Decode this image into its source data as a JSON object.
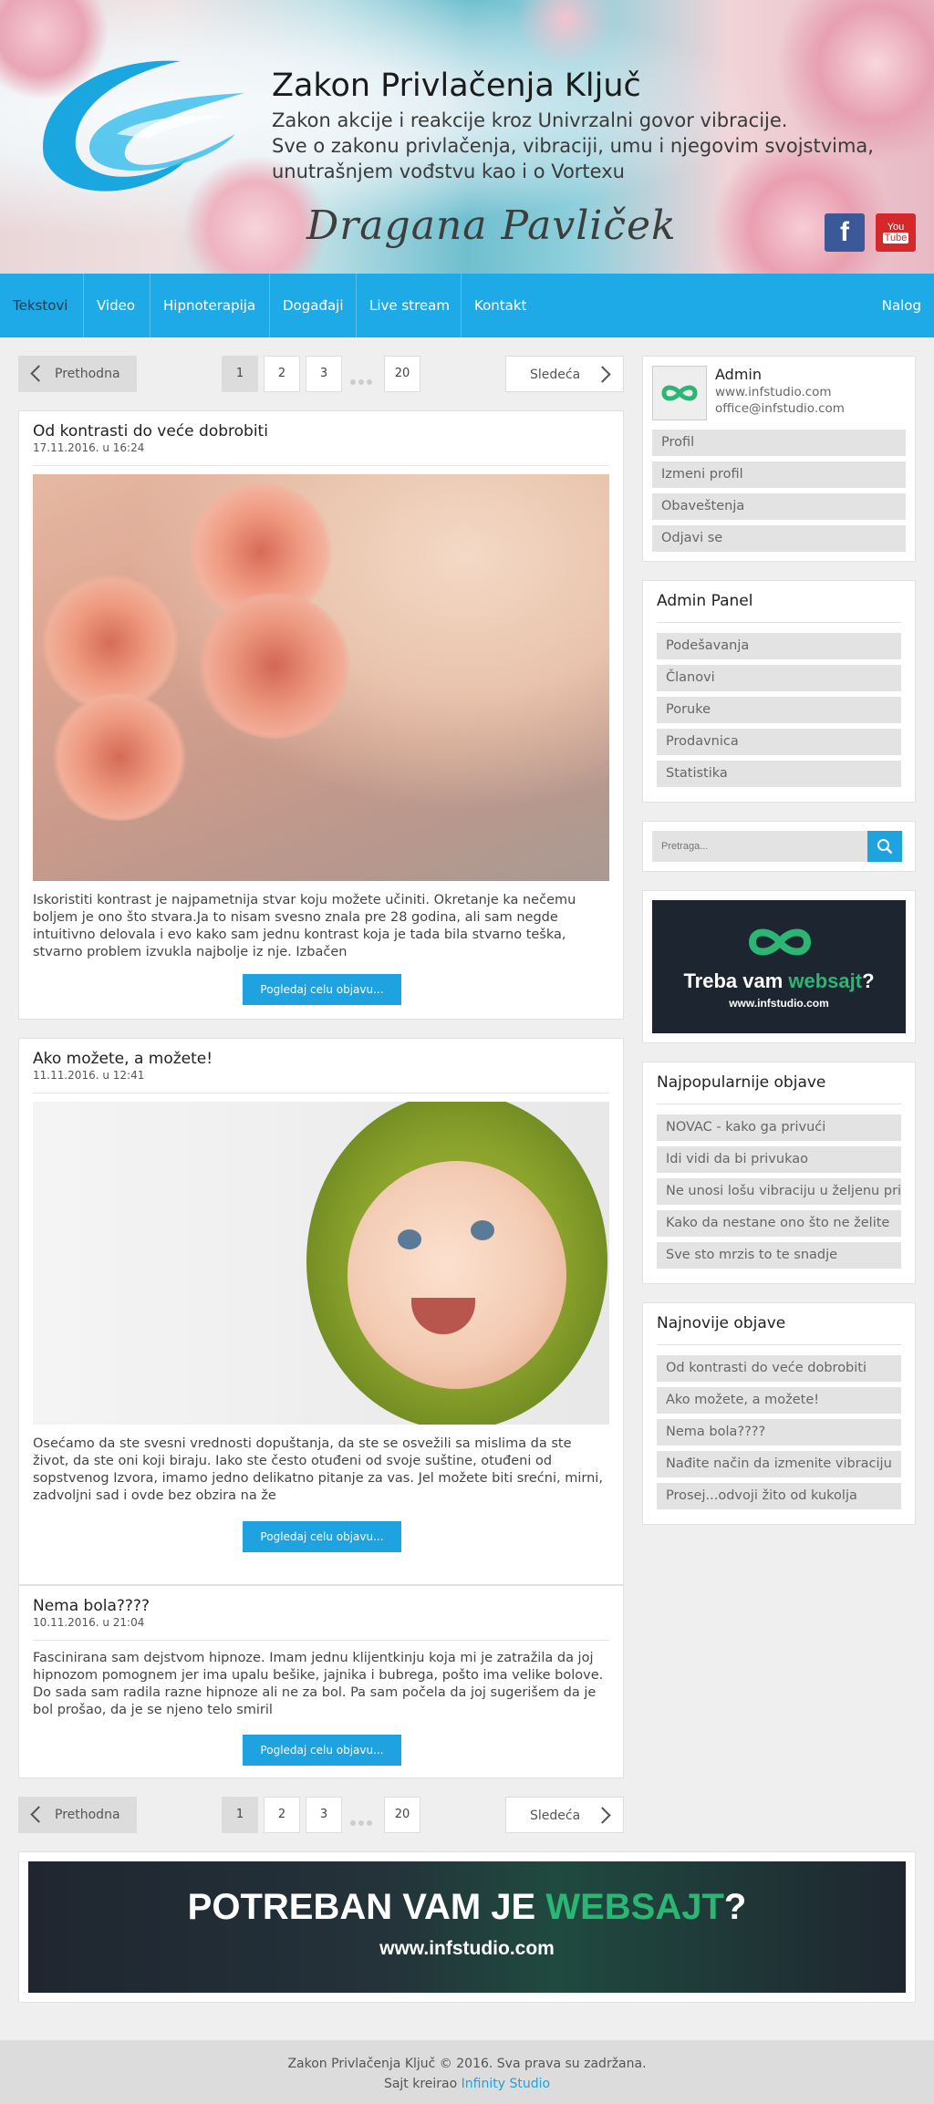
{
  "header": {
    "title": "Zakon Privlačenja Ključ",
    "tagline_lines": [
      "Zakon akcije i reakcije kroz Univrzalni govor vibracije.",
      "Sve o zakonu privlačenja, vibraciji, umu i njegovim svojstvima,",
      "unutrašnjem vođstvu kao i o Vortexu"
    ],
    "signature": "Dragana Pavliček",
    "social": {
      "facebook_glyph": "f",
      "youtube_line1": "You",
      "youtube_line2": "Tube"
    }
  },
  "nav": {
    "items": [
      "Tekstovi",
      "Video",
      "Hipnoterapija",
      "Događaji",
      "Live stream",
      "Kontakt"
    ],
    "account": "Nalog",
    "color": "#1eaae7"
  },
  "pager": {
    "prev": "Prethodna",
    "next": "Sledeća",
    "pages": [
      "1",
      "2",
      "3",
      "20"
    ],
    "current": "1"
  },
  "posts": [
    {
      "title": "Od kontrasti do veće dobrobiti",
      "date": "17.11.2016. u 16:24",
      "excerpt": "Iskoristiti kontrast je najpametnija stvar koju možete učiniti. Okretanje ka nečemu boljem je ono što stvara.Ja to nisam svesno znala pre 28 godina, ali sam negde intuitivno delovala i evo kako sam jednu kontrast koja je tada bila stvarno teška, stvarno problem izvukla najbolje iz nje. Izbačen",
      "button": "Pogledaj celu objavu..."
    },
    {
      "title": "Ako možete, a možete!",
      "date": "11.11.2016. u 12:41",
      "excerpt": "Osećamo da ste svesni vrednosti dopuštanja, da ste se osvežili sa mislima da ste život, da ste oni koji biraju. Iako ste često otuđeni od svoje suštine, otuđeni od sopstvenog Izvora, imamo jedno delikatno pitanje za vas. Jel možete biti srećni, mirni, zadvoljni sad i ovde bez obzira na že",
      "button": "Pogledaj celu objavu..."
    },
    {
      "title": "Nema bola????",
      "date": "10.11.2016. u 21:04",
      "excerpt": "Fascinirana sam dejstvom hipnoze. Imam jednu klijentkinju koja mi je zatražila da joj hipnozom pomognem jer ima upalu bešike, jajnika i bubrega, pošto ima velike bolove. Do sada sam radila razne hipnoze ali ne za bol. Pa sam počela da joj sugerišem da je bol prošao, da je se njeno telo smiril",
      "button": "Pogledaj celu objavu..."
    }
  ],
  "user_box": {
    "name": "Admin",
    "website": "www.infstudio.com",
    "email": "office@infstudio.com",
    "links": [
      "Profil",
      "Izmeni profil",
      "Obaveštenja",
      "Odjavi se"
    ]
  },
  "admin_panel": {
    "title": "Admin Panel",
    "links": [
      "Podešavanja",
      "Članovi",
      "Poruke",
      "Prodavnica",
      "Statistika"
    ]
  },
  "search": {
    "placeholder": "Pretraga..."
  },
  "side_ad": {
    "headline_pre": "Treba vam ",
    "headline_accent": "websajt",
    "headline_post": "?",
    "url": "www.infstudio.com"
  },
  "popular": {
    "title": "Najpopularnije objave",
    "links": [
      "NOVAC - kako ga privući",
      "Idi vidi da bi privukao",
      "Ne unosi lošu vibraciju u željenu priču",
      "Kako da nestane ono što ne želite",
      "Sve sto mrzis to te snadje"
    ]
  },
  "latest": {
    "title": "Najnovije objave",
    "links": [
      "Od kontrasti do veće dobrobiti",
      "Ako možete, a možete!",
      "Nema bola????",
      "Nađite način da izmenite vibraciju",
      "Prosej...odvoji žito od kukolja"
    ]
  },
  "bottom_ad": {
    "headline_pre": "POTREBAN VAM JE ",
    "headline_accent": "WEBSAJT",
    "headline_post": "?",
    "url": "www.infstudio.com"
  },
  "footer": {
    "copyright": "Zakon Privlačenja Ključ © 2016. Sva prava su zadržana.",
    "credit_prefix": "Sajt kreirao ",
    "credit_link": "Infinity Studio"
  }
}
